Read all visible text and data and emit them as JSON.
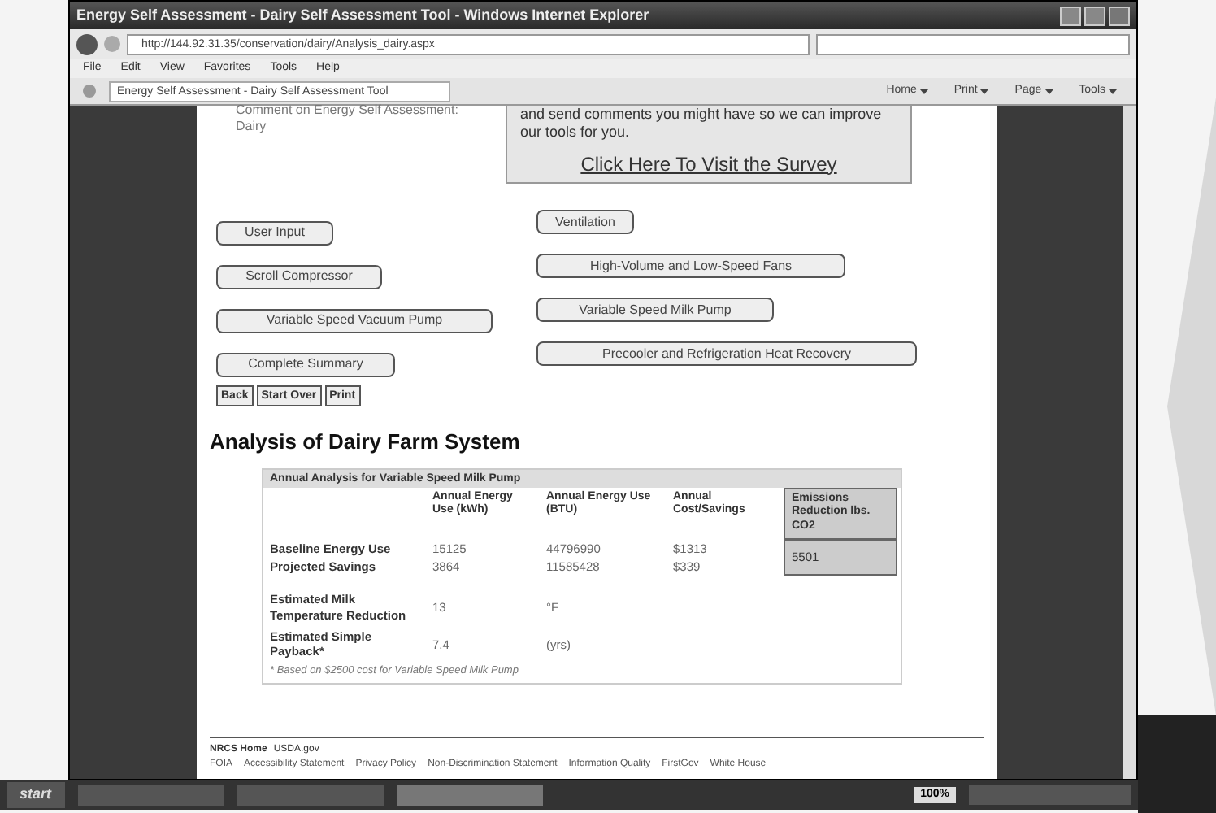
{
  "window": {
    "title": "Energy Self Assessment - Dairy Self Assessment Tool - Windows Internet Explorer"
  },
  "address": {
    "url": "http://144.92.31.35/conservation/dairy/Analysis_dairy.aspx"
  },
  "menu": [
    "File",
    "Edit",
    "View",
    "Favorites",
    "Tools",
    "Help"
  ],
  "tab": {
    "label": "Energy Self Assessment - Dairy Self Assessment Tool"
  },
  "commands": [
    "Home",
    "Print",
    "Page",
    "Tools"
  ],
  "intro": {
    "left": "Comment on Energy Self Assessment: Dairy",
    "survey_text": "and send comments you might have so we can improve our tools for you.",
    "survey_link": "Click Here To Visit the Survey"
  },
  "nav_buttons": [
    [
      "User Input",
      "Ventilation"
    ],
    [
      "Scroll Compressor",
      "High-Volume and Low-Speed Fans"
    ],
    [
      "Variable Speed Vacuum Pump",
      "Variable Speed Milk Pump"
    ],
    [
      "Complete Summary",
      "Precooler and Refrigeration Heat Recovery"
    ]
  ],
  "action_buttons": [
    "Back",
    "Start Over",
    "Print"
  ],
  "heading": "Analysis of Dairy Farm System",
  "table": {
    "title": "Annual Analysis for Variable Speed Milk Pump",
    "columns": [
      "Annual Energy Use (kWh)",
      "Annual Energy Use (BTU)",
      "Annual Cost/Savings",
      "Emissions Reduction lbs. CO2"
    ],
    "rows": [
      {
        "label": "Baseline Energy Use",
        "cells": [
          "15125",
          "44796990",
          "$1313"
        ]
      },
      {
        "label": "Projected Savings",
        "cells": [
          "3864",
          "11585428",
          "$339"
        ]
      }
    ],
    "emissions": "5501",
    "extra": [
      {
        "label": "Estimated Milk Temperature Reduction",
        "value": "13",
        "unit": "°F"
      },
      {
        "label": "Estimated Simple Payback*",
        "value": "7.4",
        "unit": "(yrs)"
      }
    ],
    "note": "* Based on $2500 cost for Variable Speed Milk Pump"
  },
  "footer": {
    "top": [
      "NRCS Home",
      "USDA.gov"
    ],
    "links": [
      "FOIA",
      "Accessibility Statement",
      "Privacy Policy",
      "Non-Discrimination Statement",
      "Information Quality",
      "FirstGov",
      "White House"
    ]
  },
  "taskbar": {
    "start": "start",
    "zoom": "100%"
  }
}
